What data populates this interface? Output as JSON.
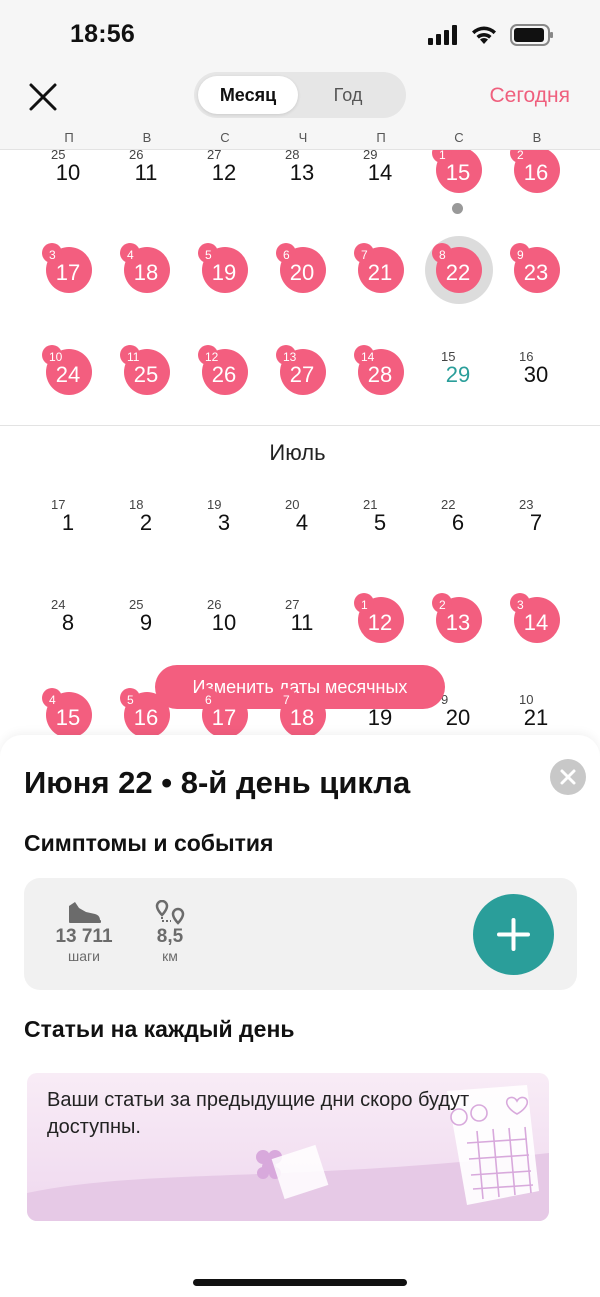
{
  "status_bar": {
    "time": "18:56"
  },
  "header": {
    "seg_month": "Месяц",
    "seg_year": "Год",
    "today": "Сегодня"
  },
  "weekdays": [
    "П",
    "В",
    "С",
    "Ч",
    "П",
    "С",
    "В"
  ],
  "calendar": {
    "july_label": "Июль",
    "edit_button": "Изменить даты месячных",
    "rows": [
      [
        {
          "s": "25",
          "d": "10"
        },
        {
          "s": "26",
          "d": "11"
        },
        {
          "s": "27",
          "d": "12"
        },
        {
          "s": "28",
          "d": "13"
        },
        {
          "s": "29",
          "d": "14"
        },
        {
          "s": "1",
          "d": "15",
          "p": true
        },
        {
          "s": "2",
          "d": "16",
          "p": true
        }
      ],
      [
        {
          "s": "3",
          "d": "17",
          "p": true
        },
        {
          "s": "4",
          "d": "18",
          "p": true
        },
        {
          "s": "5",
          "d": "19",
          "p": true
        },
        {
          "s": "6",
          "d": "20",
          "p": true
        },
        {
          "s": "7",
          "d": "21",
          "p": true
        },
        {
          "s": "8",
          "d": "22",
          "p": true,
          "sel": true
        },
        {
          "s": "9",
          "d": "23",
          "p": true
        }
      ],
      [
        {
          "s": "10",
          "d": "24",
          "p": true
        },
        {
          "s": "11",
          "d": "25",
          "p": true
        },
        {
          "s": "12",
          "d": "26",
          "p": true
        },
        {
          "s": "13",
          "d": "27",
          "p": true
        },
        {
          "s": "14",
          "d": "28",
          "p": true
        },
        {
          "s": "15",
          "d": "29",
          "teal": true
        },
        {
          "s": "16",
          "d": "30"
        }
      ],
      [
        {
          "s": "17",
          "d": "1"
        },
        {
          "s": "18",
          "d": "2"
        },
        {
          "s": "19",
          "d": "3"
        },
        {
          "s": "20",
          "d": "4"
        },
        {
          "s": "21",
          "d": "5"
        },
        {
          "s": "22",
          "d": "6"
        },
        {
          "s": "23",
          "d": "7"
        }
      ],
      [
        {
          "s": "24",
          "d": "8"
        },
        {
          "s": "25",
          "d": "9"
        },
        {
          "s": "26",
          "d": "10"
        },
        {
          "s": "27",
          "d": "11"
        },
        {
          "s": "1",
          "d": "12",
          "p": true
        },
        {
          "s": "2",
          "d": "13",
          "p": true
        },
        {
          "s": "3",
          "d": "14",
          "p": true
        }
      ],
      [
        {
          "s": "4",
          "d": "15",
          "p": true
        },
        {
          "s": "5",
          "d": "16",
          "p": true
        },
        {
          "s": "6",
          "d": "17",
          "p": true
        },
        {
          "s": "7",
          "d": "18",
          "p": true
        },
        {
          "s": "8",
          "d": "19"
        },
        {
          "s": "9",
          "d": "20"
        },
        {
          "s": "10",
          "d": "21"
        }
      ]
    ]
  },
  "sheet": {
    "title": "Июня 22 • 8-й день цикла",
    "symptoms_heading": "Симптомы и события",
    "steps_value": "13 711",
    "steps_unit": "шаги",
    "distance_value": "8,5",
    "distance_unit": "км",
    "articles_heading": "Статьи на каждый день",
    "articles_text": "Ваши статьи за предыдущие дни скоро будут доступны."
  },
  "colors": {
    "accent": "#f35e7f",
    "teal": "#2a9e9a"
  }
}
